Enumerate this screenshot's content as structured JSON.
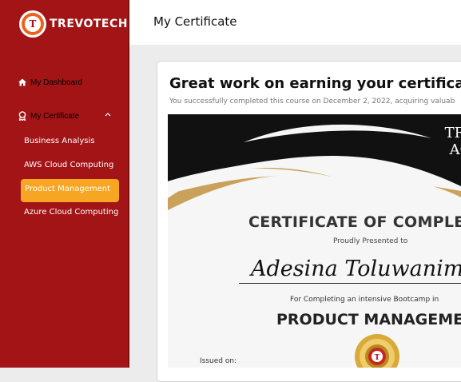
{
  "brand": {
    "name": "TREVOTECH",
    "mark": "T"
  },
  "sidebar": {
    "dashboard_label": "My Dashboard",
    "certificate_label": "My Certificate",
    "certificates": [
      {
        "label": "Business Analysis"
      },
      {
        "label": "AWS Cloud Computing"
      },
      {
        "label": "Product Management"
      },
      {
        "label": "Azure Cloud Computing"
      }
    ],
    "active_index": 2
  },
  "header": {
    "title": "My Certificate"
  },
  "card": {
    "title": "Great work on earning your certificat",
    "subtitle": "You successfully completed this course on December 2, 2022, acquiring valuab"
  },
  "certificate": {
    "brand_line1": "TRE",
    "brand_line2": "AC",
    "heading": "CERTIFICATE OF COMPLE",
    "presented": "Proudly Presented to",
    "recipient": "Adesina Toluwanimi Ma",
    "for_text": "For Completing an intensive Bootcamp in",
    "program": "PRODUCT MANAGEME",
    "issued_label": "Issued on:"
  },
  "colors": {
    "sidebar": "#a31417",
    "accent": "#f6a623",
    "gold": "#c9a15b"
  }
}
